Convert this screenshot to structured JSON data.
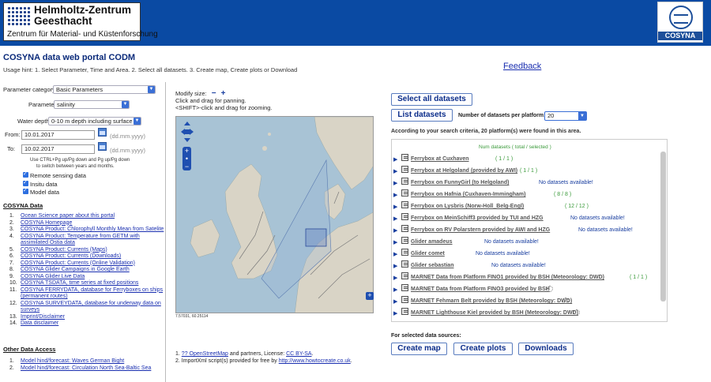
{
  "header": {
    "org_line1": "Helmholtz-Zentrum",
    "org_line2": "Geesthacht",
    "org_line3": "Zentrum für Material- und Küstenforschung",
    "right_logo_text": "COSYNA"
  },
  "page": {
    "title": "COSYNA data web portal CODM",
    "usage_hint": "Usage hint: 1. Select Parameter, Time and Area. 2. Select all datasets. 3. Create map, Create plots or Download",
    "feedback": "Feedback"
  },
  "filters": {
    "category_label": "Parameter category:",
    "category_value": "Basic Parameters",
    "parameter_label": "Parameter:",
    "parameter_value": "salinity",
    "depth_label": "Water depth:",
    "depth_value": "0-10 m depth including surface",
    "from_label": "From:",
    "from_value": "10.01.2017",
    "to_label": "To:",
    "to_value": "10.02.2017",
    "date_format": "(dd.mm.yyyy)",
    "date_hint_1": "Use CTRL+Pg up/Pg down and Pg up/Pg down",
    "date_hint_2": "to switch between years and months.",
    "checkboxes": [
      "Remote sensing data",
      "Insitu data",
      "Model data"
    ]
  },
  "cosyna_data": {
    "title": "COSYNA Data",
    "items": [
      {
        "num": "1.",
        "label": "Ocean Science paper about this portal"
      },
      {
        "num": "2.",
        "label": "COSYNA Homepage"
      },
      {
        "num": "3.",
        "label": "COSYNA Product: Chlorophyll Monthly Mean from Satelite"
      },
      {
        "num": "4.",
        "label": "COSYNA Product: Temperature from GETM with assimilated Ostia data"
      },
      {
        "num": "5.",
        "label": "COSYNA Product: Currents (Maps)"
      },
      {
        "num": "6.",
        "label": "COSYNA Product: Currents (Downloads)"
      },
      {
        "num": "7.",
        "label": "COSYNA Product: Currents (Online Validation)"
      },
      {
        "num": "8.",
        "label": "COSYNA Glider Campaigns in Google Earth"
      },
      {
        "num": "9.",
        "label": "COSYNA Glider Live Data"
      },
      {
        "num": "10.",
        "label": "COSYNA TSDATA, time series at fixed positions"
      },
      {
        "num": "11.",
        "label": "COSYNA FERRYDATA, database for Ferryboxes on ships (permanent routes)"
      },
      {
        "num": "12.",
        "label": "COSYNA SURVEYDATA, database for underway data on surveys"
      },
      {
        "num": "13.",
        "label": "Imprint/Disclaimer"
      },
      {
        "num": "14.",
        "label": "Data disclaimer"
      }
    ]
  },
  "other_data": {
    "title": "Other Data Access",
    "items": [
      {
        "num": "1.",
        "label": "Model hind/forecast: Waves German Bight"
      },
      {
        "num": "2.",
        "label": "Model hind/forecast: Circulation North Sea-Baltic Sea"
      }
    ]
  },
  "map": {
    "modify_size": "Modify size:",
    "minus": "−",
    "plus": "+",
    "instr_1": "Click and drag for panning.",
    "instr_2": "<SHIFT>-click and drag for zooming.",
    "coords": "7.57031, 60.25114",
    "credit_1_num": "1.",
    "credit_1_link": "?? OpenStreetMap",
    "credit_1_text": " and partners, License: ",
    "credit_1_license": "CC BY-SA",
    "credit_1_end": ".",
    "credit_2_num": "2.",
    "credit_2_text": "ImportXml script(s) provided for free by ",
    "credit_2_link": "http://www.howtocreate.co.uk",
    "credit_2_end": "."
  },
  "datasets": {
    "select_all": "Select all datasets",
    "list_btn": "List datasets",
    "per_platform_label": "Number of datasets per platform:",
    "per_platform_value": "20",
    "search_info": "According to your search criteria, 20 platform(s) were found in this area.",
    "column_header": "Num datasets ( total / selected )",
    "items": [
      {
        "name": "Ferrybox at Cuxhaven",
        "status": "( 1 / 1 )",
        "kind": "count",
        "spinner": false
      },
      {
        "name": "Ferrybox at Helgoland (provided by AWI)",
        "status": "( 1 / 1 )",
        "kind": "count",
        "spinner": false
      },
      {
        "name": "Ferrybox on FunnyGirl (to Helgoland)",
        "status": "No datasets available!",
        "kind": "none",
        "spinner": false
      },
      {
        "name": "Ferrybox on Hafnia (Cuxhaven-Immingham)",
        "status": "( 8 / 8 )",
        "kind": "count",
        "spinner": false
      },
      {
        "name": "Ferrybox on Lysbris (Norw-Holl_Belg-Engl)",
        "status": "( 12 / 12 )",
        "kind": "count",
        "spinner": false
      },
      {
        "name": "Ferrybox on MeinSchiff3 provided by TUI and HZG",
        "status": "No datasets available!",
        "kind": "none",
        "spinner": false
      },
      {
        "name": "Ferrybox on RV Polarstern provided by AWI and HZG",
        "status": "No datasets available!",
        "kind": "none",
        "spinner": false
      },
      {
        "name": "Glider amadeus",
        "status": "No datasets available!",
        "kind": "none",
        "spinner": false
      },
      {
        "name": "Glider comet",
        "status": "No datasets available!",
        "kind": "none",
        "spinner": false
      },
      {
        "name": "Glider sebastian",
        "status": "No datasets available!",
        "kind": "none",
        "spinner": false
      },
      {
        "name": "MARNET Data from Platform FINO1 provided by BSH (Meteorology: DWD)",
        "status": "( 1 / 1 )",
        "kind": "count",
        "spinner": false
      },
      {
        "name": "MARNET Data from Platform FINO3 provided by BSH",
        "status": "",
        "kind": "none",
        "spinner": true
      },
      {
        "name": "MARNET Fehmarn Belt provided by BSH (Meteorology: DWD)",
        "status": "",
        "kind": "none",
        "spinner": true
      },
      {
        "name": "MARNET Lighthouse Kiel provided by BSH (Meteorology: DWD)",
        "status": "",
        "kind": "none",
        "spinner": true
      }
    ],
    "selected_label": "For selected data sources:",
    "create_map": "Create map",
    "create_plots": "Create plots",
    "downloads": "Downloads"
  }
}
